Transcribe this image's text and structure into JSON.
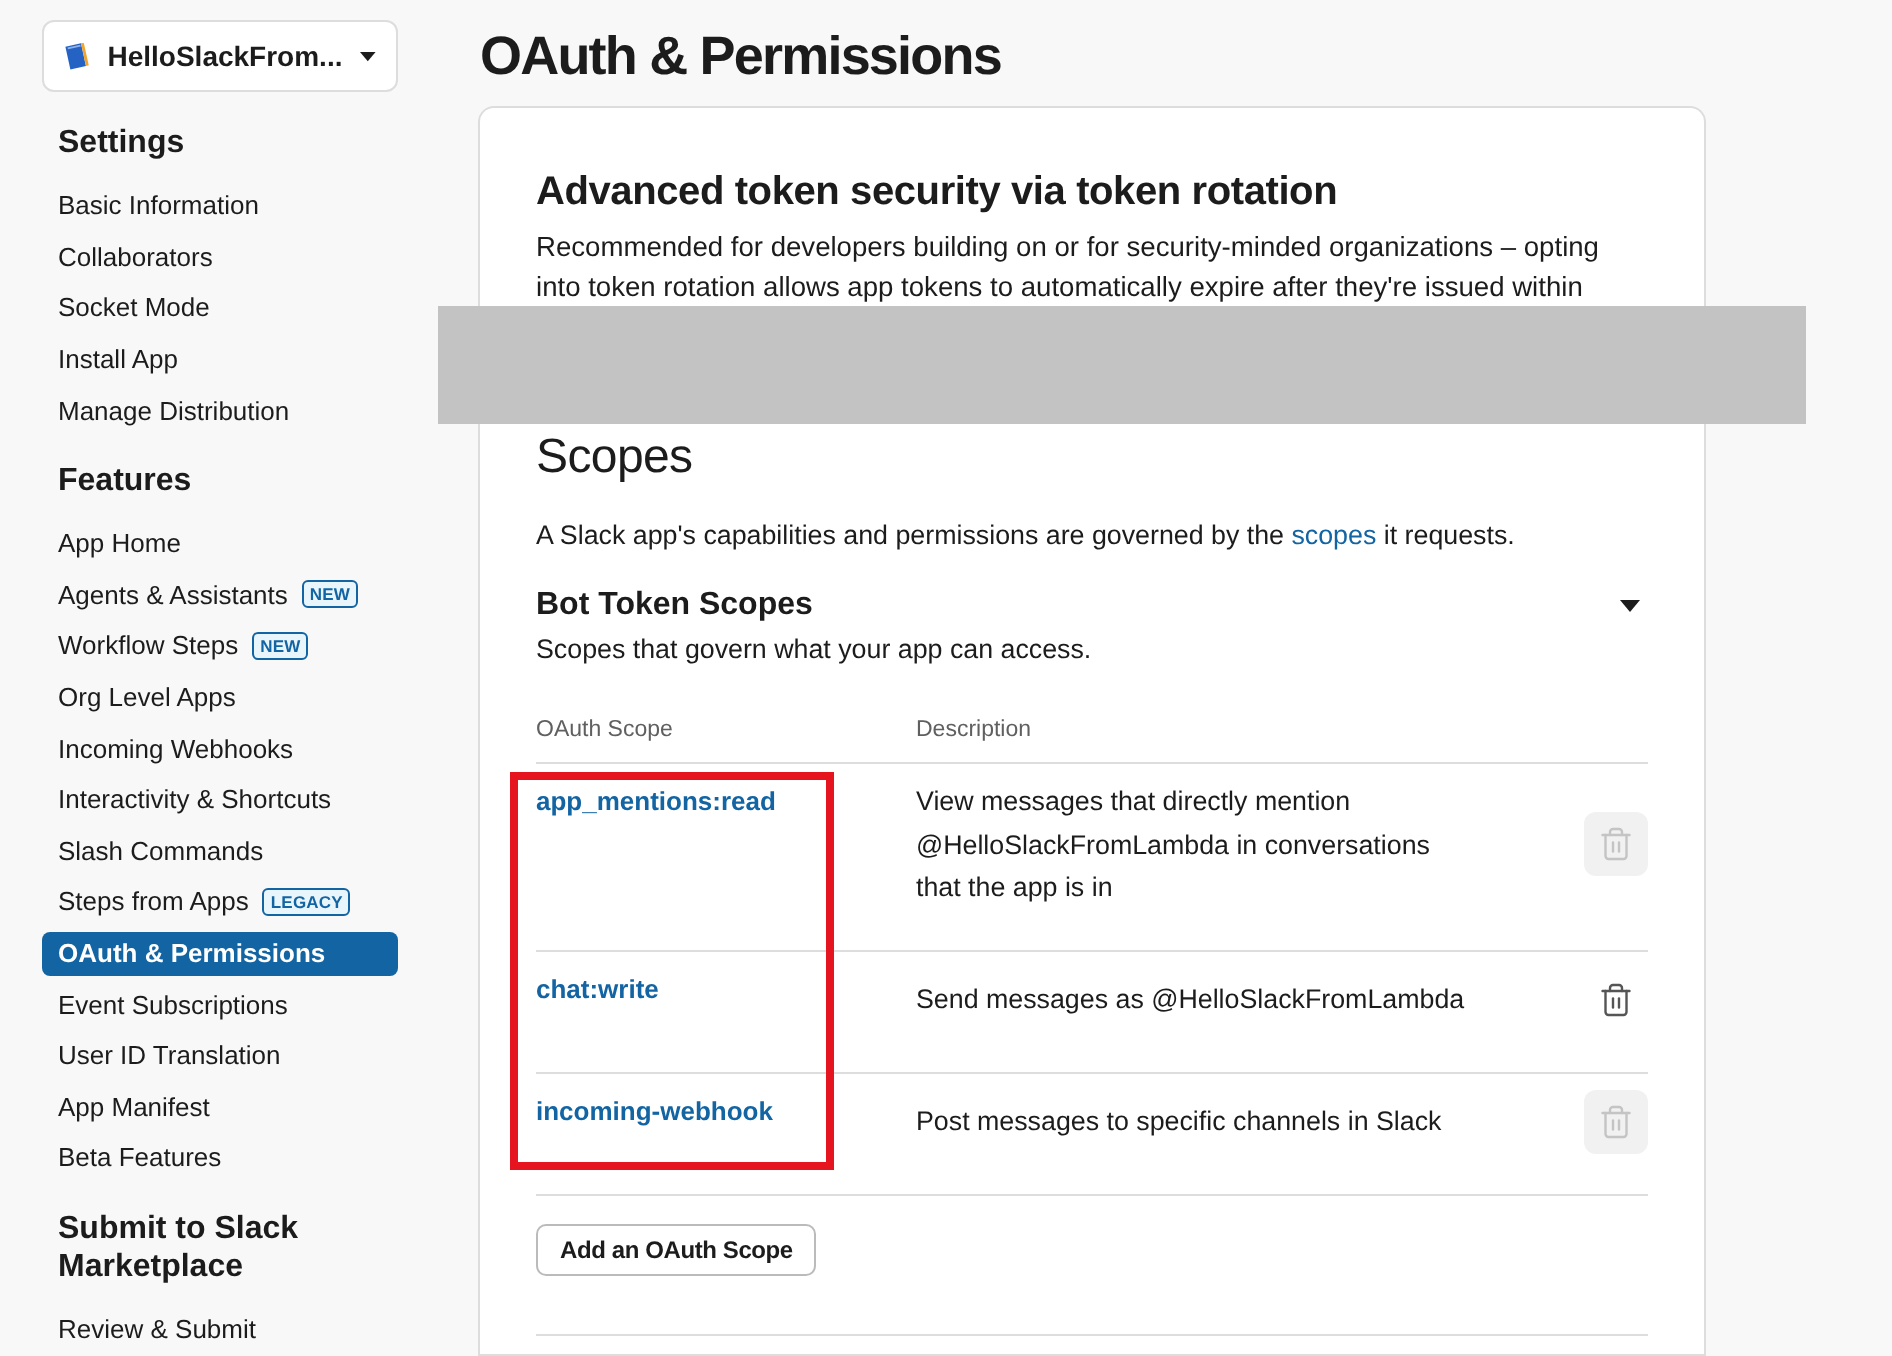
{
  "app_switcher": {
    "name": "HelloSlackFrom..."
  },
  "sidebar": {
    "sections": [
      {
        "title": "Settings",
        "items": [
          {
            "label": "Basic Information",
            "selected": false
          },
          {
            "label": "Collaborators",
            "selected": false
          },
          {
            "label": "Socket Mode",
            "selected": false
          },
          {
            "label": "Install App",
            "selected": false
          },
          {
            "label": "Manage Distribution",
            "selected": false
          }
        ]
      },
      {
        "title": "Features",
        "items": [
          {
            "label": "App Home",
            "selected": false
          },
          {
            "label": "Agents & Assistants",
            "badge": "NEW",
            "selected": false
          },
          {
            "label": "Workflow Steps",
            "badge": "NEW",
            "selected": false
          },
          {
            "label": "Org Level Apps",
            "selected": false
          },
          {
            "label": "Incoming Webhooks",
            "selected": false
          },
          {
            "label": "Interactivity & Shortcuts",
            "selected": false
          },
          {
            "label": "Slash Commands",
            "selected": false
          },
          {
            "label": "Steps from Apps",
            "badge": "LEGACY",
            "selected": false
          },
          {
            "label": "OAuth & Permissions",
            "selected": true
          },
          {
            "label": "Event Subscriptions",
            "selected": false
          },
          {
            "label": "User ID Translation",
            "selected": false
          },
          {
            "label": "App Manifest",
            "selected": false
          },
          {
            "label": "Beta Features",
            "selected": false
          }
        ]
      },
      {
        "title": "Submit to Slack Marketplace",
        "items": [
          {
            "label": "Review & Submit",
            "selected": false
          }
        ]
      }
    ]
  },
  "page_title": "OAuth & Permissions",
  "token_rotation": {
    "heading": "Advanced token security via token rotation",
    "description": "Recommended for developers building on or for security-minded organizations – opting into token rotation allows app tokens to automatically expire after they're issued within",
    "covered": true
  },
  "scopes": {
    "heading": "Scopes",
    "intro": {
      "before": "A Slack app's capabilities and permissions are governed by the ",
      "link": "scopes",
      "after": " it requests."
    }
  },
  "bot_token_scopes": {
    "heading": "Bot Token Scopes",
    "subtitle": "Scopes that govern what your app can access.",
    "expanded": true,
    "columns": [
      "OAuth Scope",
      "Description"
    ],
    "scope_column_highlighted": true,
    "rows": [
      {
        "scope": "app_mentions:read",
        "description": "View messages that directly mention @HelloSlackFromLambda in conversations that the app is in",
        "delete_disabled": true
      },
      {
        "scope": "chat:write",
        "description": "Send messages as @HelloSlackFromLambda",
        "delete_disabled": false
      },
      {
        "scope": "incoming-webhook",
        "description": "Post messages to specific channels in Slack",
        "delete_disabled": true
      }
    ],
    "add_button": "Add an OAuth Scope"
  }
}
